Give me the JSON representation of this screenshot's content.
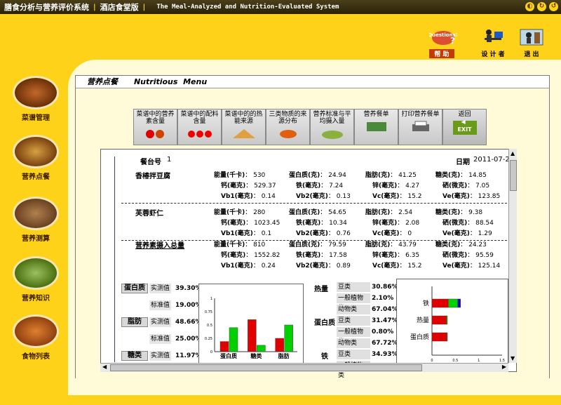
{
  "titlebar": {
    "title_cn": "膳食分析与营养评价系统",
    "edition": "酒店食堂版",
    "title_en": "The Meal-Analyzed and Nutrition-Evaluated System"
  },
  "window_controls": [
    "◐",
    "↻",
    "↺"
  ],
  "top_icons": [
    {
      "name": "help",
      "label": "帮 助",
      "sub": "Questions?"
    },
    {
      "name": "designer",
      "label": "设 计 者"
    },
    {
      "name": "exit",
      "label": "退 出"
    }
  ],
  "sidebar": [
    {
      "label": "菜谱管理"
    },
    {
      "label": "营养点餐"
    },
    {
      "label": "营养测算"
    },
    {
      "label": "营养知识"
    },
    {
      "label": "食物列表"
    }
  ],
  "panel": {
    "title": "营养点餐      Nutritious  Menu"
  },
  "toolbar": [
    {
      "label": "菜谱中的营养素含量"
    },
    {
      "label": "菜谱中的配料含量"
    },
    {
      "label": "菜谱中的的热能来源"
    },
    {
      "label": "三类物质的来源分布"
    },
    {
      "label": "营养标准与平均摄入量"
    },
    {
      "label": "营养餐单"
    },
    {
      "label": "打印营养餐单"
    },
    {
      "label": "返回",
      "exit": "EXIT"
    }
  ],
  "report": {
    "table_no_label": "餐台号",
    "table_no": "1",
    "date_label": "日期",
    "date": "2011-07-23",
    "dishes": [
      {
        "name": "香椿拌豆腐",
        "rows": [
          [
            [
              "能量(千卡)",
              "530"
            ],
            [
              "蛋白质(克)",
              "24.94"
            ],
            [
              "脂肪(克)",
              "41.25"
            ],
            [
              "糖类(克)",
              "14.85"
            ]
          ],
          [
            [
              "钙(毫克)",
              "529.37"
            ],
            [
              "铁(毫克)",
              "7.24"
            ],
            [
              "锌(毫克)",
              "4.27"
            ],
            [
              "硒(微克)",
              "7.05"
            ]
          ],
          [
            [
              "Vb1(毫克)",
              "0.14"
            ],
            [
              "Vb2(毫克)",
              "0.13"
            ],
            [
              "Vc(毫克)",
              "15.2"
            ],
            [
              "Ve(毫克)",
              "123.85"
            ]
          ]
        ]
      },
      {
        "name": "芙蓉虾仁",
        "rows": [
          [
            [
              "能量(千卡)",
              "280"
            ],
            [
              "蛋白质(克)",
              "54.65"
            ],
            [
              "脂肪(克)",
              "2.54"
            ],
            [
              "糖类(克)",
              "9.38"
            ]
          ],
          [
            [
              "钙(毫克)",
              "1023.45"
            ],
            [
              "铁(毫克)",
              "10.34"
            ],
            [
              "锌(毫克)",
              "2.08"
            ],
            [
              "硒(微克)",
              "88.54"
            ]
          ],
          [
            [
              "Vb1(毫克)",
              "0.1"
            ],
            [
              "Vb2(毫克)",
              "0.76"
            ],
            [
              "Vc(毫克)",
              "0"
            ],
            [
              "Ve(毫克)",
              "1.29"
            ]
          ]
        ]
      },
      {
        "name": "营养素摄入总量",
        "rows": [
          [
            [
              "能量(千卡)",
              "810"
            ],
            [
              "蛋白质(克)",
              "79.59"
            ],
            [
              "脂肪(克)",
              "43.79"
            ],
            [
              "糖类(克)",
              "24.23"
            ]
          ],
          [
            [
              "钙(毫克)",
              "1552.82"
            ],
            [
              "铁(毫克)",
              "17.58"
            ],
            [
              "锌(毫克)",
              "6.35"
            ],
            [
              "硒(微克)",
              "95.59"
            ]
          ],
          [
            [
              "Vb1(毫克)",
              "0.24"
            ],
            [
              "Vb2(毫克)",
              "0.89"
            ],
            [
              "Vc(毫克)",
              "15.2"
            ],
            [
              "Ve(毫克)",
              "125.14"
            ]
          ]
        ]
      }
    ],
    "ratios": [
      {
        "name": "蛋白质",
        "measured_label": "实测值",
        "measured": "39.30%",
        "standard_label": "标准值",
        "standard": "19.00%"
      },
      {
        "name": "脂肪",
        "measured_label": "实测值",
        "measured": "48.66%",
        "standard_label": "标准值",
        "standard": "25.00%"
      },
      {
        "name": "糖类",
        "measured_label": "实测值",
        "measured": "11.97%"
      }
    ],
    "sources": [
      {
        "name": "热量",
        "items": [
          [
            "豆类",
            "30.86%"
          ],
          [
            "一般植物类",
            "2.10%"
          ],
          [
            "动物类",
            "67.04%"
          ]
        ]
      },
      {
        "name": "蛋白质",
        "items": [
          [
            "豆类",
            "31.47%"
          ],
          [
            "一般植物类",
            "0.80%"
          ],
          [
            "动物类",
            "67.72%"
          ]
        ]
      },
      {
        "name": "铁",
        "items": [
          [
            "豆类",
            "34.93%"
          ],
          [
            "一般植物类",
            ""
          ]
        ]
      }
    ]
  },
  "chart_data": [
    {
      "type": "bar",
      "categories": [
        "蛋白质",
        "糖类",
        "脂肪"
      ],
      "series": [
        {
          "values": [
            0.19,
            0.6,
            0.25
          ]
        },
        {
          "values": [
            0.45,
            0.12,
            0.5
          ]
        }
      ],
      "y_ticks": [
        "0",
        "0.25",
        "0.5",
        "0.75",
        "1"
      ],
      "ylim": [
        0,
        1
      ],
      "colors": [
        "#e00000",
        "#00d000"
      ]
    },
    {
      "type": "bar",
      "orientation": "horizontal-stacked",
      "categories": [
        "铁",
        "热量",
        "蛋白质"
      ],
      "series": [
        {
          "values": [
            0.35,
            0.31,
            0.32
          ]
        },
        {
          "values": [
            0.2,
            0.02,
            0.01
          ]
        },
        {
          "values": [
            0.06,
            0.0,
            0.0
          ]
        }
      ],
      "x_ticks": [
        "0",
        "0.5",
        "1",
        "1.5"
      ],
      "xlim": [
        0,
        1.5
      ],
      "colors": [
        "#e00000",
        "#00d000",
        "#0000c8"
      ]
    }
  ]
}
